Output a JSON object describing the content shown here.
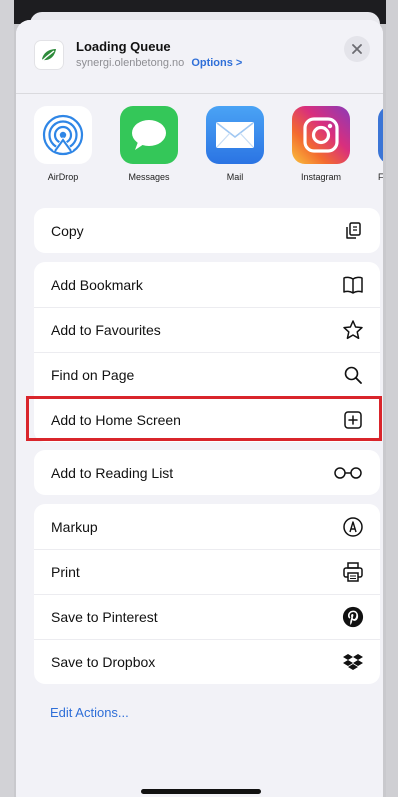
{
  "header": {
    "title": "Loading Queue",
    "subtitle": "synergi.olenbetong.no",
    "options_label": "Options >"
  },
  "apps": [
    {
      "name": "airdrop",
      "label": "AirDrop"
    },
    {
      "name": "messages",
      "label": "Messages"
    },
    {
      "name": "mail",
      "label": "Mail"
    },
    {
      "name": "instagram",
      "label": "Instagram"
    },
    {
      "name": "facebook",
      "label": "Fa"
    }
  ],
  "groups": {
    "copy": [
      {
        "label": "Copy",
        "icon": "copy-icon"
      }
    ],
    "page": [
      {
        "label": "Add Bookmark",
        "icon": "book-icon"
      },
      {
        "label": "Add to Favourites",
        "icon": "star-icon"
      },
      {
        "label": "Find on Page",
        "icon": "search-icon"
      },
      {
        "label": "Add to Home Screen",
        "icon": "add-square-icon"
      }
    ],
    "reading": [
      {
        "label": "Add to Reading List",
        "icon": "glasses-icon"
      }
    ],
    "actions": [
      {
        "label": "Markup",
        "icon": "markup-icon"
      },
      {
        "label": "Print",
        "icon": "printer-icon"
      },
      {
        "label": "Save to Pinterest",
        "icon": "pinterest-icon"
      },
      {
        "label": "Save to Dropbox",
        "icon": "dropbox-icon"
      }
    ]
  },
  "edit_actions_label": "Edit Actions...",
  "colors": {
    "accent": "#2f6fd8",
    "highlight": "#d9252b",
    "messages": "#34c759",
    "mail": "#3b8df0",
    "sheet_bg": "#f2f2f7"
  }
}
